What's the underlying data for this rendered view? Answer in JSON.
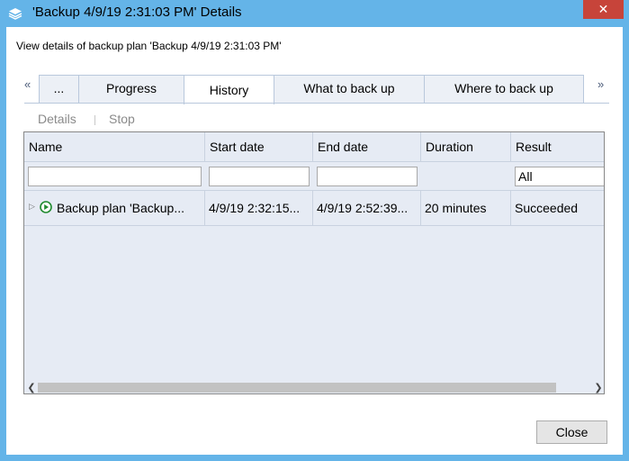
{
  "window": {
    "title": "'Backup 4/9/19 2:31:03 PM' Details",
    "app_icon": "layers-icon",
    "close_glyph": "✕",
    "accent_color": "#64b4e8"
  },
  "header": {
    "text": "View details of backup plan 'Backup 4/9/19 2:31:03 PM'"
  },
  "tabs": {
    "scroll_left": "«",
    "scroll_right": "»",
    "items": [
      {
        "label": "..."
      },
      {
        "label": "Progress"
      },
      {
        "label": "History"
      },
      {
        "label": "What to back up"
      },
      {
        "label": "Where to back up"
      }
    ],
    "active": "History"
  },
  "toolbar": {
    "details_label": "Details",
    "stop_label": "Stop"
  },
  "grid": {
    "columns": [
      "Name",
      "Start date",
      "End date",
      "Duration",
      "Result"
    ],
    "filters": {
      "result_value": "All"
    },
    "rows": [
      {
        "name": "Backup plan 'Backup...",
        "start": "4/9/19 2:32:15...",
        "end": "4/9/19 2:52:39...",
        "duration": "20 minutes",
        "result": "Succeeded",
        "status_icon": "play-circle-icon"
      }
    ]
  },
  "footer": {
    "close_label": "Close"
  }
}
